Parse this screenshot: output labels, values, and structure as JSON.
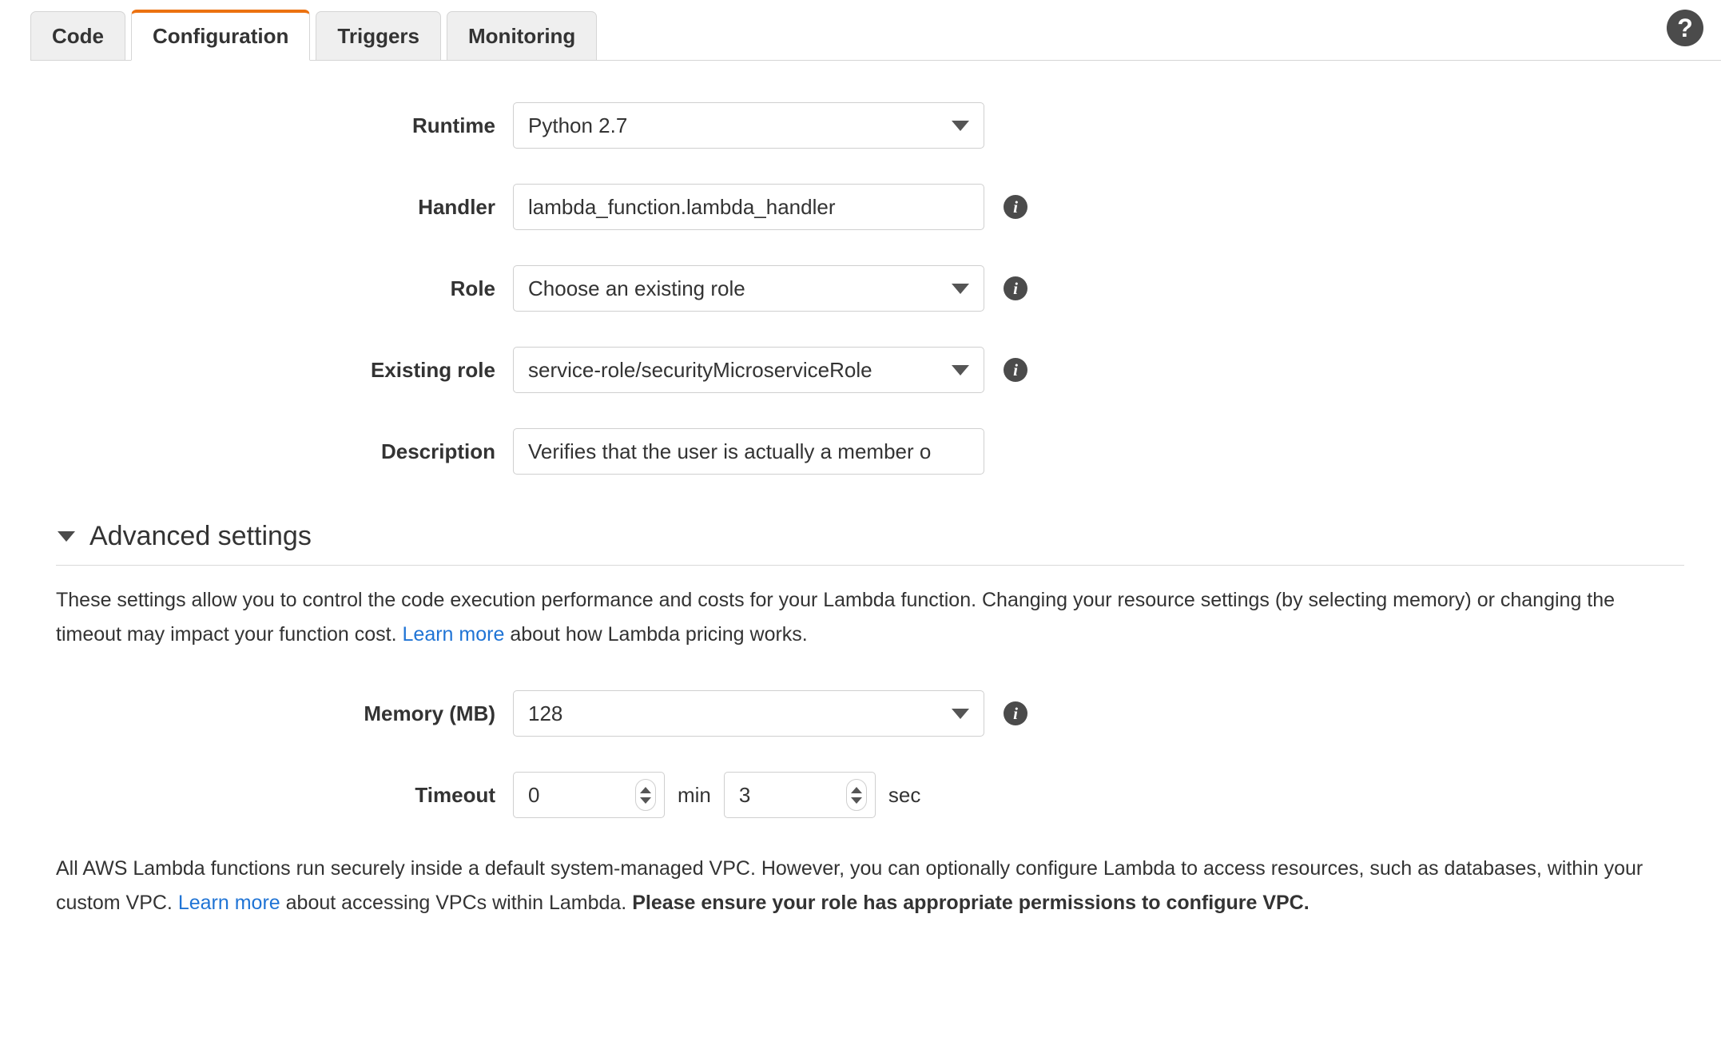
{
  "tabs": [
    {
      "label": "Code",
      "active": false
    },
    {
      "label": "Configuration",
      "active": true
    },
    {
      "label": "Triggers",
      "active": false
    },
    {
      "label": "Monitoring",
      "active": false
    }
  ],
  "help": {
    "glyph": "?"
  },
  "form": {
    "runtime": {
      "label": "Runtime",
      "value": "Python 2.7"
    },
    "handler": {
      "label": "Handler",
      "value": "lambda_function.lambda_handler"
    },
    "role": {
      "label": "Role",
      "value": "Choose an existing role"
    },
    "existing_role": {
      "label": "Existing role",
      "value": "service-role/securityMicroserviceRole"
    },
    "description": {
      "label": "Description",
      "value": "Verifies that the user is actually a member o"
    }
  },
  "advanced": {
    "title": "Advanced settings",
    "expanded_glyph": "triangle-down",
    "intro_part1": "These settings allow you to control the code execution performance and costs for your Lambda function. Changing your resource settings (by selecting memory) or changing the timeout may impact your function cost. ",
    "intro_link": "Learn more",
    "intro_part2": " about how Lambda pricing works.",
    "memory": {
      "label": "Memory (MB)",
      "value": "128"
    },
    "timeout": {
      "label": "Timeout",
      "minutes": "0",
      "minutes_unit": "min",
      "seconds": "3",
      "seconds_unit": "sec"
    },
    "vpc_part1": "All AWS Lambda functions run securely inside a default system-managed VPC. However, you can optionally configure Lambda to access resources, such as databases, within your custom VPC. ",
    "vpc_link": "Learn more",
    "vpc_part2": " about accessing VPCs within Lambda. ",
    "vpc_bold": "Please ensure your role has appropriate permissions to configure VPC."
  },
  "icons": {
    "info": "i",
    "caret_down": "caret-down-icon"
  },
  "colors": {
    "accent": "#ec7211",
    "link": "#2074d5",
    "border": "#cfcfcf",
    "text": "#333333"
  }
}
